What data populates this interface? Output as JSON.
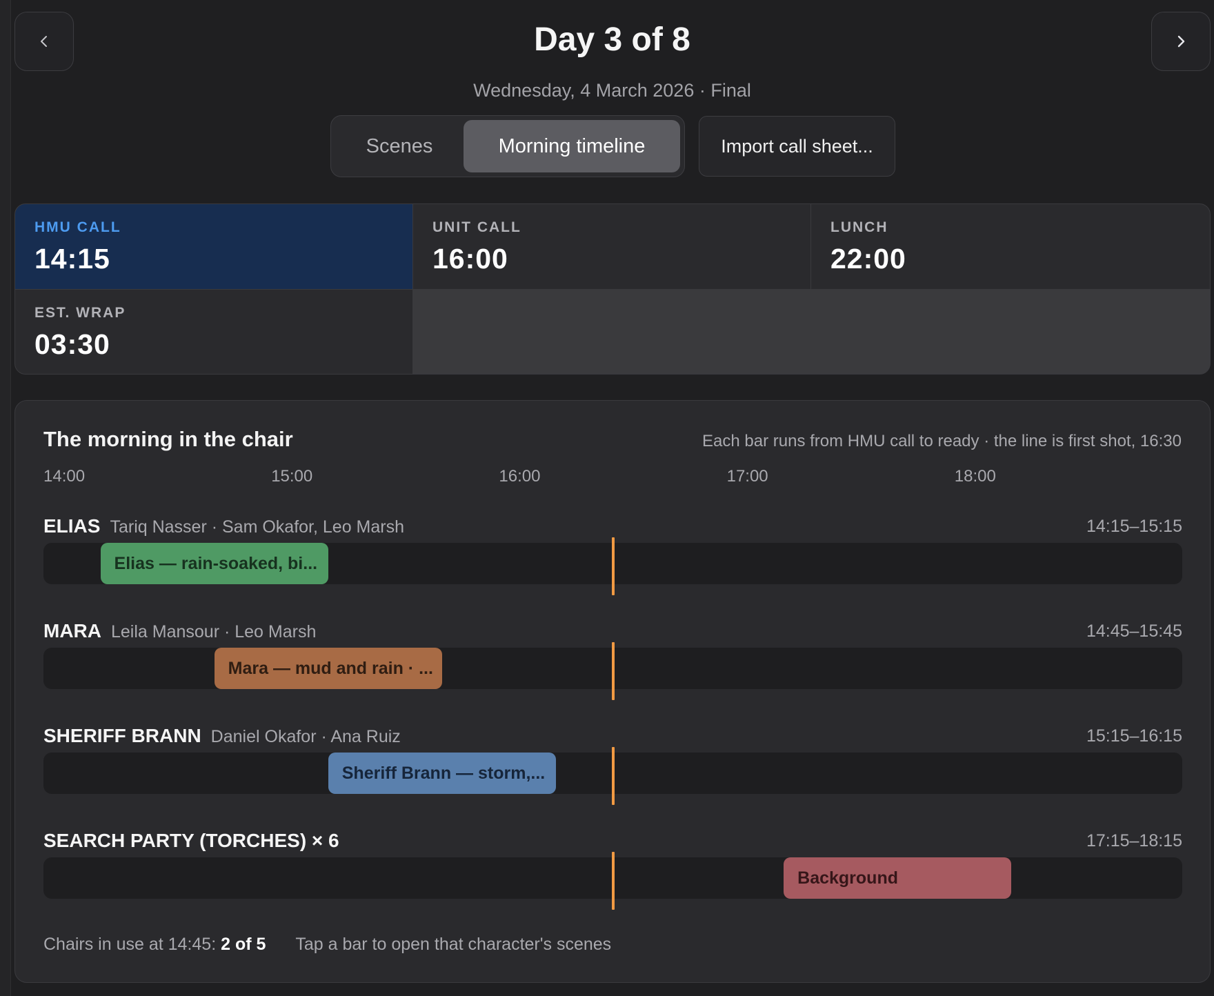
{
  "header": {
    "title": "Day 3 of 8",
    "subtitle": "Wednesday, 4 March 2026 · Final",
    "prev_icon": "chevron-left-icon",
    "next_icon": "chevron-right-icon"
  },
  "tabs": [
    {
      "label": "Scenes",
      "selected": false
    },
    {
      "label": "Morning timeline",
      "selected": true
    }
  ],
  "import_button": "Import call sheet...",
  "calls": [
    {
      "label": "HMU CALL",
      "time": "14:15",
      "highlighted": true
    },
    {
      "label": "UNIT CALL",
      "time": "16:00",
      "highlighted": false
    },
    {
      "label": "LUNCH",
      "time": "22:00",
      "highlighted": false
    },
    {
      "label": "EST. WRAP",
      "time": "03:30",
      "highlighted": false
    }
  ],
  "chair_panel": {
    "title": "The morning in the chair",
    "caption": "Each bar runs from HMU call to ready · the line is first shot, 16:30",
    "axis_start_minutes": 840,
    "axis_end_minutes": 1140,
    "ticks": [
      "14:00",
      "15:00",
      "16:00",
      "17:00",
      "18:00"
    ],
    "first_shot": "16:30",
    "rows": [
      {
        "name": "ELIAS",
        "people": "Tariq Nasser · Sam Okafor, Leo Marsh",
        "range": "14:15–15:15",
        "start": "14:15",
        "end": "15:15",
        "bar_label": "Elias — rain-soaked, bi...",
        "color": "#4f9a64",
        "text_color": "#17321f"
      },
      {
        "name": "MARA",
        "people": "Leila Mansour · Leo Marsh",
        "range": "14:45–15:45",
        "start": "14:45",
        "end": "15:45",
        "bar_label": "Mara — mud and rain · ...",
        "color": "#a86b45",
        "text_color": "#2f1d12"
      },
      {
        "name": "SHERIFF BRANN",
        "people": "Daniel Okafor · Ana Ruiz",
        "range": "15:15–16:15",
        "start": "15:15",
        "end": "16:15",
        "bar_label": "Sheriff Brann — storm,...",
        "color": "#5a80ad",
        "text_color": "#16253a"
      },
      {
        "name": "SEARCH PARTY (TORCHES) × 6",
        "people": "",
        "range": "17:15–18:15",
        "start": "17:15",
        "end": "18:15",
        "bar_label": "Background",
        "color": "#a65a60",
        "text_color": "#361619"
      }
    ],
    "footer": {
      "chairs_label": "Chairs in use at 14:45:",
      "chairs_value": "2 of 5",
      "hint": "Tap a bar to open that character's scenes"
    }
  }
}
